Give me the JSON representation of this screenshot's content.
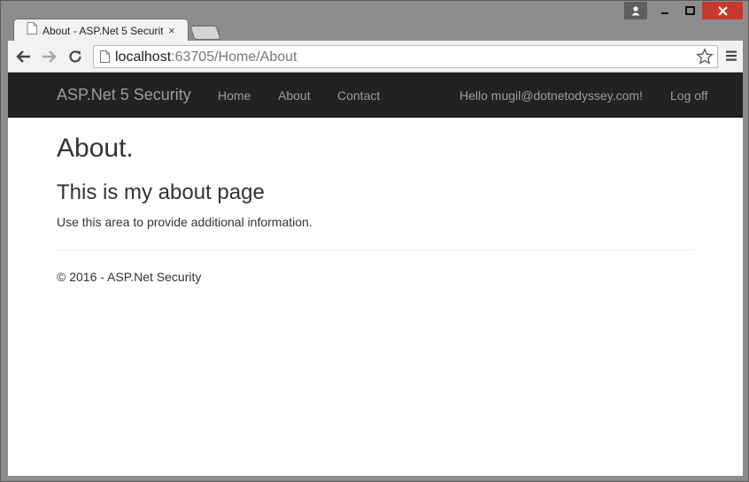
{
  "browser": {
    "tab_title": "About - ASP.Net 5 Securit",
    "tab_close": "×",
    "url_host": "localhost",
    "url_rest": ":63705/Home/About"
  },
  "navbar": {
    "brand": "ASP.Net 5 Security",
    "links": [
      "Home",
      "About",
      "Contact"
    ],
    "greeting": "Hello mugil@dotnetodyssey.com!",
    "logoff": "Log off"
  },
  "page": {
    "title": "About.",
    "subtitle": "This is my about page",
    "body": "Use this area to provide additional information.",
    "footer": "© 2016 - ASP.Net Security"
  },
  "colors": {
    "navbar_bg": "#222222",
    "navbar_text": "#9d9d9d",
    "close_button": "#c6392c"
  }
}
